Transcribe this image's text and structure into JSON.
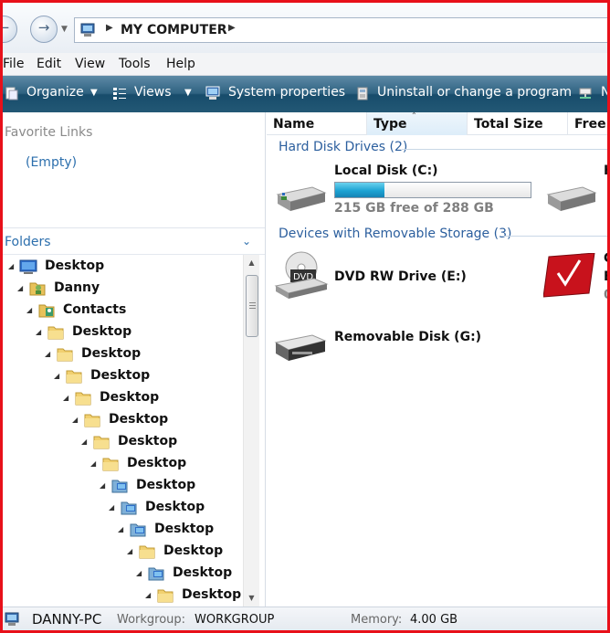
{
  "address": {
    "path": "MY COMPUTER"
  },
  "menu": [
    "File",
    "Edit",
    "View",
    "Tools",
    "Help"
  ],
  "toolbar": {
    "organize": "Organize",
    "views": "Views",
    "system_properties": "System properties",
    "uninstall": "Uninstall or change a program",
    "overflow_clip": "N"
  },
  "favorites": {
    "title": "Favorite Links",
    "empty": "(Empty)"
  },
  "folders": {
    "title": "Folders",
    "tree": [
      {
        "label": "Desktop",
        "icon": "computer-desktop-icon"
      },
      {
        "label": "Danny",
        "icon": "user-folder-icon"
      },
      {
        "label": "Contacts",
        "icon": "contacts-folder-icon"
      },
      {
        "label": "Desktop",
        "icon": "folder-icon"
      },
      {
        "label": "Desktop",
        "icon": "folder-icon"
      },
      {
        "label": "Desktop",
        "icon": "folder-icon"
      },
      {
        "label": "Desktop",
        "icon": "folder-icon"
      },
      {
        "label": "Desktop",
        "icon": "folder-icon"
      },
      {
        "label": "Desktop",
        "icon": "folder-icon"
      },
      {
        "label": "Desktop",
        "icon": "folder-icon"
      },
      {
        "label": "Desktop",
        "icon": "desktop-folder-icon"
      },
      {
        "label": "Desktop",
        "icon": "desktop-folder-icon"
      },
      {
        "label": "Desktop",
        "icon": "desktop-folder-icon"
      },
      {
        "label": "Desktop",
        "icon": "folder-icon"
      },
      {
        "label": "Desktop",
        "icon": "desktop-folder-icon"
      },
      {
        "label": "Desktop",
        "icon": "folder-icon"
      }
    ]
  },
  "columns": {
    "name": "Name",
    "type": "Type",
    "total_size": "Total Size",
    "free_space": "Free S"
  },
  "hard_disks": {
    "group_label": "Hard Disk Drives (2)",
    "local_disk": {
      "name": "Local Disk (C:)",
      "free_text": "215 GB free of 288 GB",
      "used_fraction": 0.25
    },
    "second_disk_clip": "H"
  },
  "removable": {
    "group_label": "Devices with Removable Storage (3)",
    "dvd": {
      "name": "DVD RW Drive (E:)"
    },
    "removable_disk": {
      "name": "Removable Disk (G:)"
    },
    "clipped_device": {
      "line1": "C",
      "line2": "E",
      "line3": "0"
    }
  },
  "status": {
    "pc_name": "DANNY-PC",
    "workgroup_label": "Workgroup:",
    "workgroup_value": "WORKGROUP",
    "memory_label": "Memory:",
    "memory_value": "4.00 GB"
  },
  "colors": {
    "frame": "#e8101a",
    "toolbar": "#2f6281",
    "link": "#2c6fad",
    "group_header": "#2c5f9e",
    "bar_fill": "#1da3d3"
  }
}
